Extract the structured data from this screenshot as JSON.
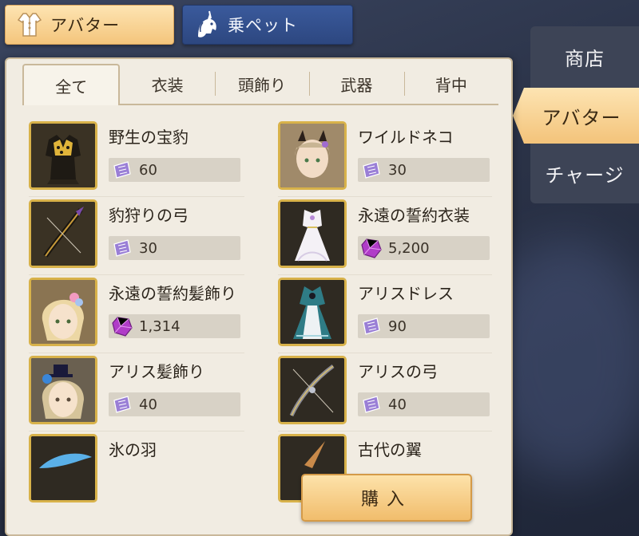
{
  "top_tabs": {
    "avatar": {
      "label": "アバター",
      "icon": "outfit-icon"
    },
    "pet": {
      "label": "乗ペット",
      "icon": "unicorn-icon"
    }
  },
  "side_menu": {
    "items": [
      {
        "label": "商店",
        "active": false
      },
      {
        "label": "アバター",
        "active": true
      },
      {
        "label": "チャージ",
        "active": false
      }
    ]
  },
  "sub_tabs": [
    {
      "label": "全て",
      "active": true
    },
    {
      "label": "衣装",
      "active": false
    },
    {
      "label": "頭飾り",
      "active": false
    },
    {
      "label": "武器",
      "active": false
    },
    {
      "label": "背中",
      "active": false
    }
  ],
  "items": [
    {
      "name": "野生の宝豹",
      "price": "60",
      "currency": "ticket-icon",
      "thumb": "armor-outfit"
    },
    {
      "name": "ワイルドネコ",
      "price": "30",
      "currency": "ticket-icon",
      "thumb": "cat-ears-head"
    },
    {
      "name": "豹狩りの弓",
      "price": "30",
      "currency": "ticket-icon",
      "thumb": "leopard-bow"
    },
    {
      "name": "永遠の誓約衣装",
      "price": "5,200",
      "currency": "gem-icon",
      "thumb": "white-dress"
    },
    {
      "name": "永遠の誓約髪飾り",
      "price": "1,314",
      "currency": "gem-icon",
      "thumb": "flower-hair-head"
    },
    {
      "name": "アリスドレス",
      "price": "90",
      "currency": "ticket-icon",
      "thumb": "alice-dress"
    },
    {
      "name": "アリス髪飾り",
      "price": "40",
      "currency": "ticket-icon",
      "thumb": "hat-hair-head"
    },
    {
      "name": "アリスの弓",
      "price": "40",
      "currency": "ticket-icon",
      "thumb": "alice-bow"
    },
    {
      "name": "氷の羽",
      "price": "",
      "currency": "",
      "thumb": "ice-wing"
    },
    {
      "name": "古代の翼",
      "price": "",
      "currency": "",
      "thumb": "ancient-wing"
    }
  ],
  "buy_button": {
    "label": "購入"
  },
  "colors": {
    "accent_gold": "#f4c57c",
    "tab_blue": "#2d4780",
    "panel_bg": "#f1ece2",
    "thumb_border": "#d8b24a",
    "gem_purple": "#b03cc8",
    "ticket_purple": "#9a7fd6"
  }
}
